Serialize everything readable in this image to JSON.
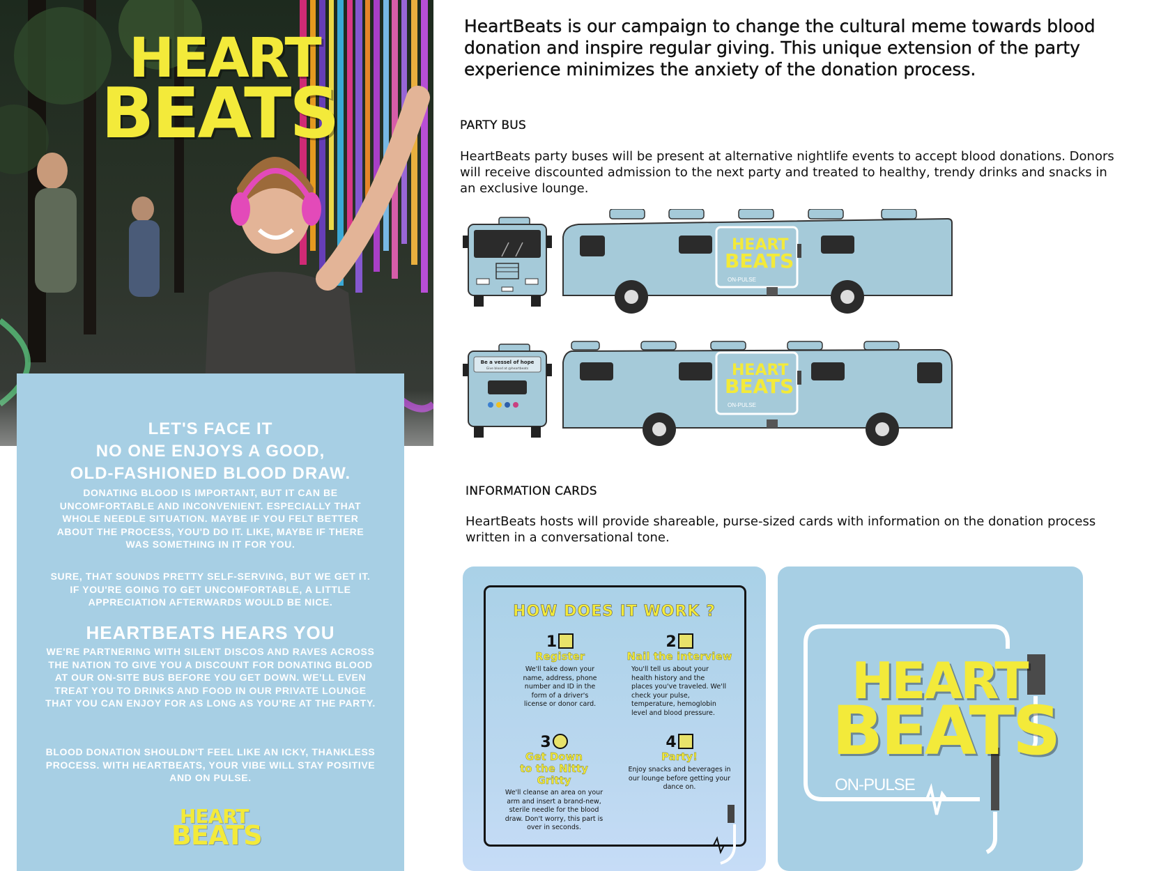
{
  "colors": {
    "panel_blue": "#a7cfe4",
    "logo_yellow": "#f3ea3a",
    "bus_blue": "#a5cad9"
  },
  "poster": {
    "logo": {
      "line1": "HEART",
      "line2": "BEATS"
    },
    "heading1": "LET'S FACE IT\nNO ONE ENJOYS A GOOD,\nOLD-FASHIONED BLOOD DRAW.",
    "para1": "DONATING BLOOD IS IMPORTANT, BUT IT CAN BE UNCOMFORTABLE AND INCONVENIENT. ESPECIALLY THAT WHOLE NEEDLE SITUATION. MAYBE IF YOU FELT BETTER ABOUT THE PROCESS, YOU'D DO IT. LIKE, MAYBE IF THERE WAS SOMETHING IN IT FOR YOU.",
    "para2": "SURE, THAT SOUNDS PRETTY SELF-SERVING, BUT WE GET IT. IF YOU'RE GOING TO GET UNCOMFORTABLE, A LITTLE APPRECIATION AFTERWARDS WOULD BE NICE.",
    "heading2": "HEARTBEATS HEARS YOU",
    "para3": "WE'RE PARTNERING WITH SILENT DISCOS AND RAVES ACROSS THE NATION TO GIVE YOU A DISCOUNT FOR DONATING BLOOD AT OUR ON-SITE BUS BEFORE YOU GET DOWN. WE'LL EVEN TREAT YOU TO DRINKS AND FOOD IN OUR PRIVATE LOUNGE THAT YOU CAN ENJOY FOR AS LONG AS YOU'RE AT THE PARTY.",
    "para4": "BLOOD DONATION SHOULDN'T FEEL LIKE AN ICKY, THANKLESS PROCESS. WITH HEARTBEATS, YOUR VIBE WILL STAY POSITIVE AND ON PULSE.",
    "footer_logo": {
      "line1": "HEART",
      "line2": "BEATS"
    }
  },
  "intro": "HeartBeats is our campaign to change the cultural meme towards blood donation and inspire regular giving. This unique extension of the party experience minimizes the anxiety of the donation process.",
  "party_bus": {
    "title": "PARTY BUS",
    "description": "HeartBeats party buses will be present at alternative nightlife events to accept blood donations. Donors will receive discounted admission to the next party and treated to healthy, trendy drinks and snacks in an exclusive lounge.",
    "bus_logo": {
      "line1": "HEART",
      "line2": "BEATS",
      "tag": "ON-PULSE"
    },
    "rear_window_text": "Be a vessel of hope",
    "rear_window_subtext": "Give blood at @heartbeats"
  },
  "info_cards": {
    "title": "INFORMATION CARDS",
    "description": "HeartBeats hosts will provide shareable, purse-sized cards with information on the donation process written in a conversational tone.",
    "card1": {
      "heading": "HOW DOES IT WORK ?",
      "steps": [
        {
          "num": "1",
          "title": "Register",
          "body": "We'll take down your name, address, phone number and ID in the form of a driver's license or donor card."
        },
        {
          "num": "2",
          "title": "Nail the interview",
          "body": "You'll tell us about your health history and the places you've traveled. We'll check your pulse, temperature, hemoglobin level and blood pressure."
        },
        {
          "num": "3",
          "title": "Get Down to the Nitty Gritty",
          "body": "We'll cleanse an area on your arm and insert a brand-new, sterile needle for the blood draw. Don't worry, this part is over in seconds."
        },
        {
          "num": "4",
          "title": "Party!",
          "body": "Enjoy snacks and beverages in our lounge before getting your dance on."
        }
      ]
    },
    "card2": {
      "line1": "HEART",
      "line2": "BEATS",
      "tag": "ON-PULSE"
    }
  }
}
